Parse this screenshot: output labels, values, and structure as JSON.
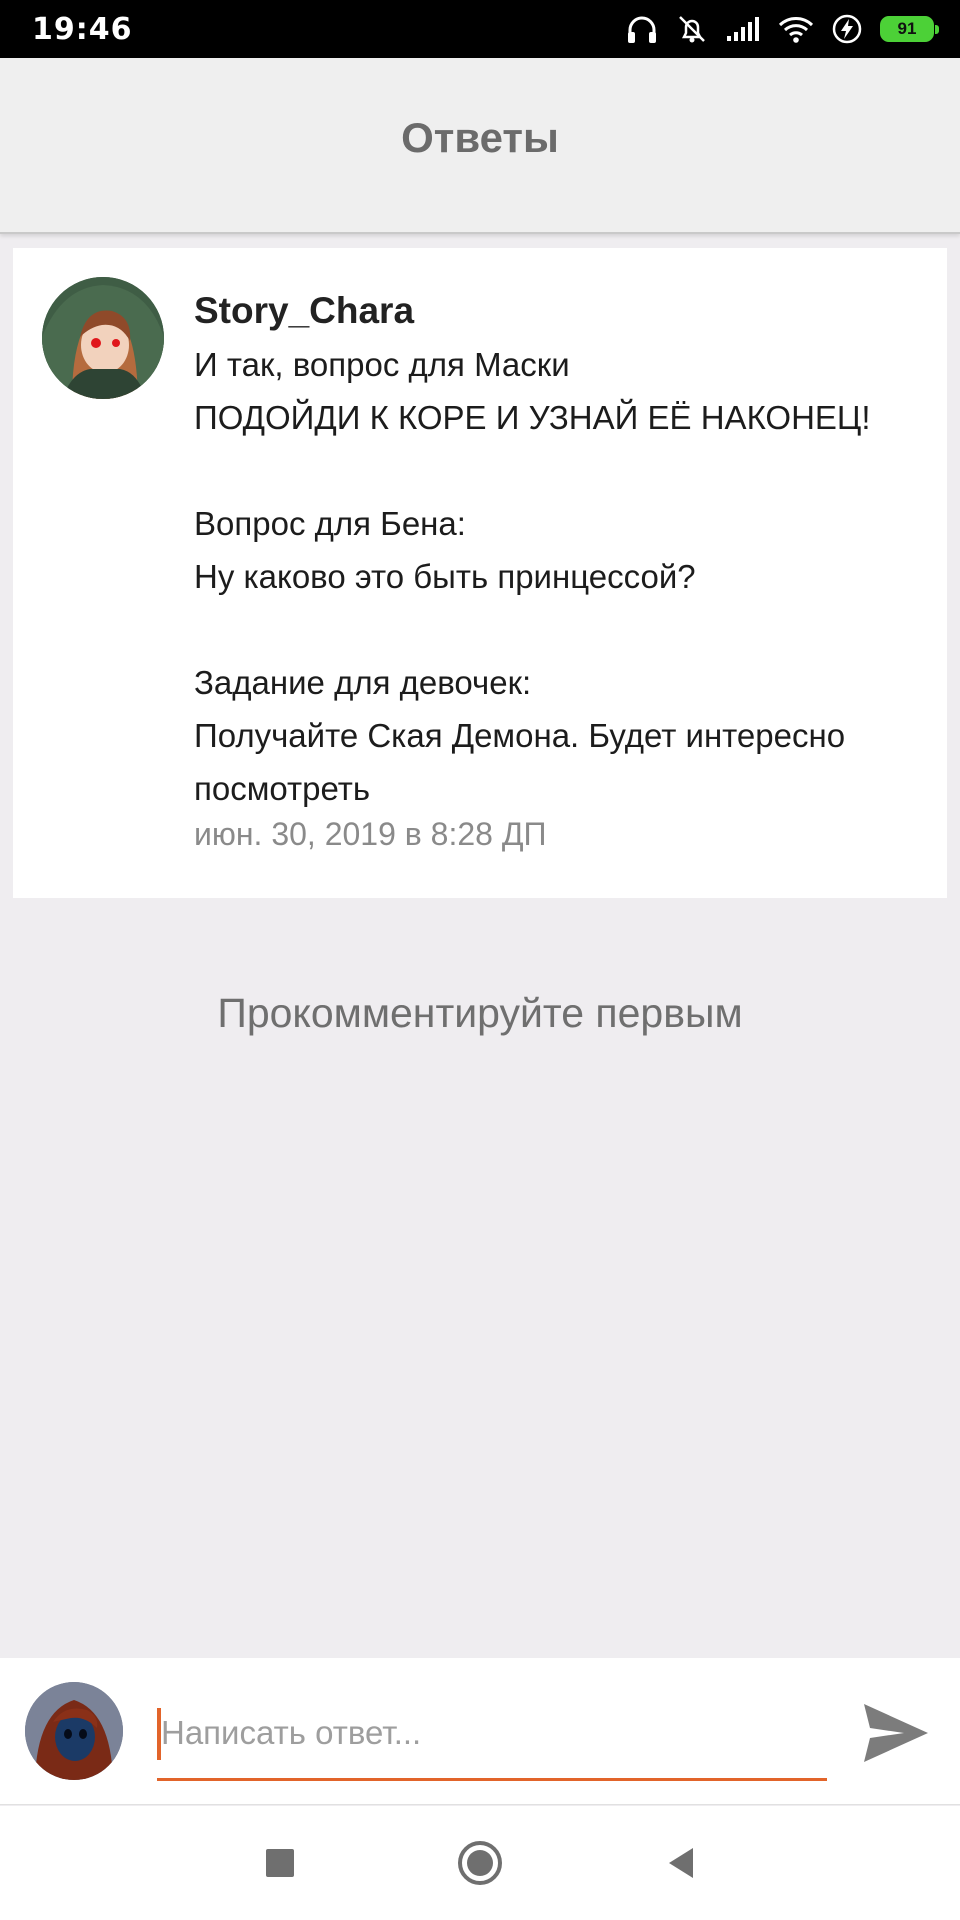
{
  "status_bar": {
    "time": "19:46",
    "battery": "91",
    "icons": [
      "headphones-icon",
      "alarm-muted-icon",
      "signal-icon",
      "wifi-icon",
      "charging-icon",
      "battery-icon"
    ]
  },
  "header": {
    "title": "Ответы"
  },
  "post": {
    "author": "Story_Chara",
    "lines": [
      "И так, вопрос для Маски",
      "ПОДОЙДИ К КОРЕ И УЗНАЙ ЕЁ НАКОНЕЦ!",
      "",
      "Вопрос для Бена:",
      "Ну каково это быть принцессой?",
      "",
      "Задание для девочек:",
      "Получайте Ская Демона. Будет интересно",
      "посмотреть"
    ],
    "date": "июн. 30, 2019 в 8:28 ДП"
  },
  "comments": {
    "empty_text": "Прокомментируйте первым"
  },
  "reply": {
    "placeholder": "Написать ответ...",
    "value": ""
  },
  "nav": {
    "icons": [
      "recents-icon",
      "home-icon",
      "back-icon"
    ]
  },
  "colors": {
    "accent": "#e2642a",
    "battery": "#4cd137",
    "background": "#efedf0"
  }
}
